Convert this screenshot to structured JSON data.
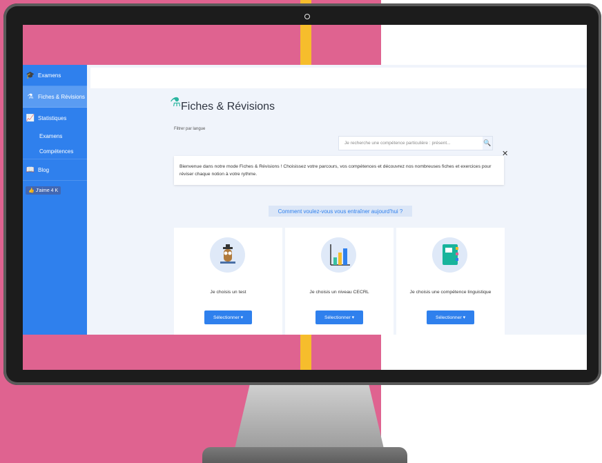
{
  "sidebar": {
    "items": [
      {
        "label": "Examens",
        "icon": "graduation-cap-icon"
      },
      {
        "label": "Fiches & Révisions",
        "icon": "flask-icon",
        "active": true
      },
      {
        "label": "Statistiques",
        "icon": "chart-line-icon"
      },
      {
        "label": "Blog",
        "icon": "book-icon"
      }
    ],
    "sub_items": [
      "Examens",
      "Compétences"
    ],
    "like_label": "J'aime 4 K"
  },
  "main": {
    "title": "Fiches & Révisions",
    "filter_label": "Filtrer par langue",
    "search_placeholder": "Je recherche une compétence particulière : présent...",
    "welcome_text": "Bienvenue dans notre mode Fiches & Révisions ! Choisissez votre parcours, vos compétences et découvrez nos nombreuses fiches et exercices pour réviser chaque notion à votre rythme.",
    "question": "Comment voulez-vous vous entraîner aujourd'hui ?",
    "cards": [
      {
        "label": "Je choisis un test",
        "button": "Sélectionner ▾",
        "icon": "owl-graduate-icon"
      },
      {
        "label": "Je choisis un niveau CECRL",
        "button": "Sélectionner ▾",
        "icon": "bar-chart-icon"
      },
      {
        "label": "Je choisis une compétence linguistique",
        "button": "Sélectionner ▾",
        "icon": "notebook-icon"
      }
    ]
  },
  "colors": {
    "accent": "#2f80ed",
    "background_pink": "#df6390",
    "background_yellow": "#f6bd2c"
  }
}
